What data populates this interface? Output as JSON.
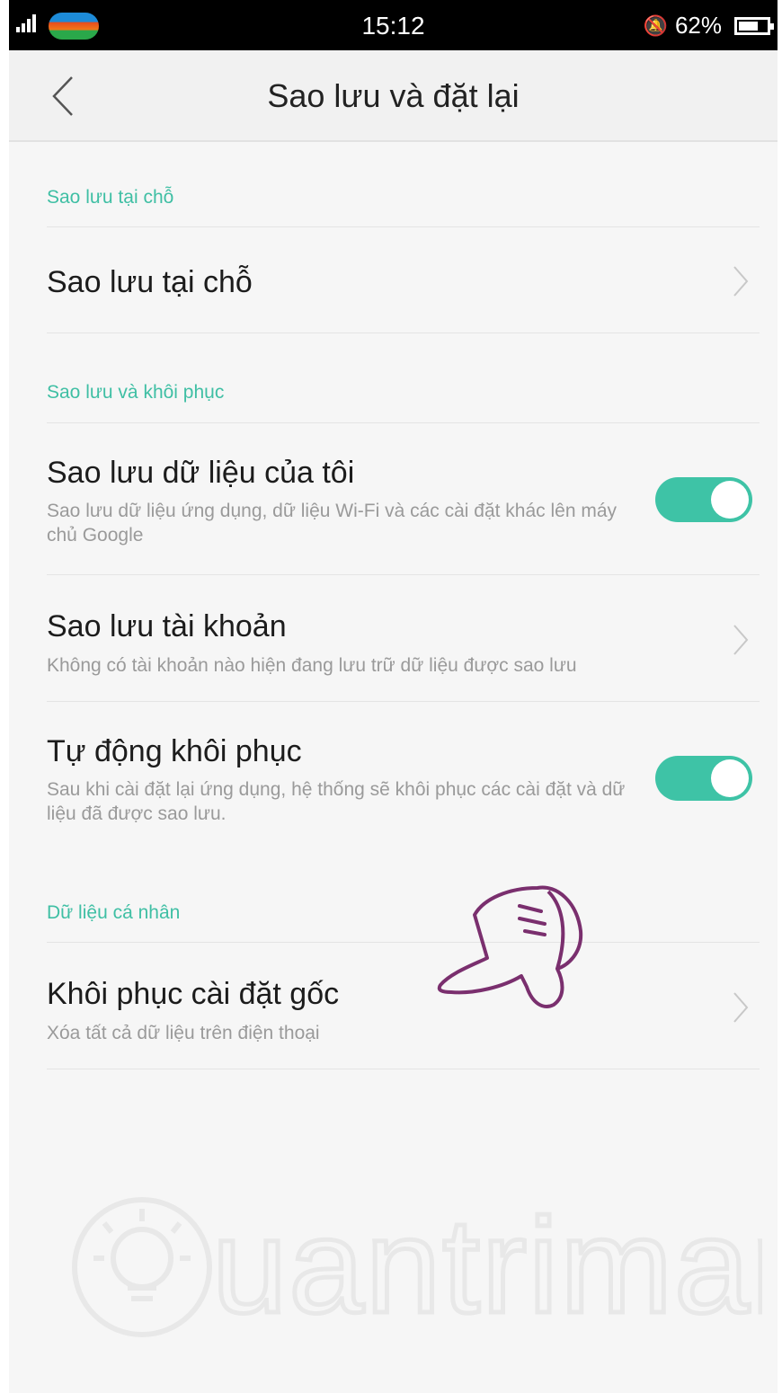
{
  "status_bar": {
    "time": "15:12",
    "battery_text": "62%",
    "battery_level": 0.62,
    "icons": [
      "signal-icon",
      "carrier-logo-icon",
      "bell-mute-icon",
      "battery-icon"
    ]
  },
  "header": {
    "title": "Sao lưu và đặt lại",
    "back_icon": "chevron-left-icon"
  },
  "sections": [
    {
      "label": "Sao lưu tại chỗ",
      "rows": [
        {
          "title": "Sao lưu tại chỗ",
          "subtitle": "",
          "control": "chevron"
        }
      ]
    },
    {
      "label": "Sao lưu và khôi phục",
      "rows": [
        {
          "title": "Sao lưu dữ liệu của tôi",
          "subtitle": "Sao lưu dữ liệu ứng dụng, dữ liệu Wi-Fi và các cài đặt khác lên máy chủ Google",
          "control": "toggle",
          "toggle_on": true
        },
        {
          "title": "Sao lưu tài khoản",
          "subtitle": "Không có tài khoản nào hiện đang lưu trữ dữ liệu được sao lưu",
          "control": "chevron"
        },
        {
          "title": "Tự động khôi phục",
          "subtitle": "Sau khi cài đặt lại ứng dụng, hệ thống sẽ khôi phục các cài đặt và dữ liệu đã được sao lưu.",
          "control": "toggle",
          "toggle_on": true
        }
      ]
    },
    {
      "label": "Dữ liệu cá nhân",
      "rows": [
        {
          "title": "Khôi phục cài đặt gốc",
          "subtitle": "Xóa tất cả dữ liệu trên điện thoại",
          "control": "chevron"
        }
      ]
    }
  ],
  "colors": {
    "accent": "#3ec3a6",
    "annotation": "#7a2f6e"
  },
  "watermark": "Quantrimang"
}
